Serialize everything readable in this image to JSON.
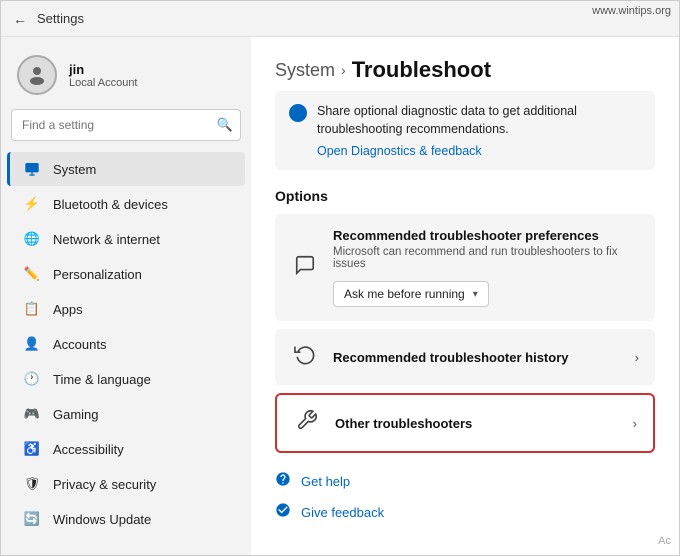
{
  "window": {
    "title": "Settings",
    "watermark": "www.wintips.org"
  },
  "titlebar": {
    "back_label": "←",
    "title": "Settings"
  },
  "sidebar": {
    "user": {
      "name": "jin",
      "type": "Local Account"
    },
    "search": {
      "placeholder": "Find a setting",
      "icon": "🔍"
    },
    "items": [
      {
        "id": "system",
        "label": "System",
        "icon": "🖥",
        "active": true
      },
      {
        "id": "bluetooth",
        "label": "Bluetooth & devices",
        "icon": "📶"
      },
      {
        "id": "network",
        "label": "Network & internet",
        "icon": "🌐"
      },
      {
        "id": "personalization",
        "label": "Personalization",
        "icon": "✏️"
      },
      {
        "id": "apps",
        "label": "Apps",
        "icon": "📦"
      },
      {
        "id": "accounts",
        "label": "Accounts",
        "icon": "👤"
      },
      {
        "id": "time",
        "label": "Time & language",
        "icon": "🕐"
      },
      {
        "id": "gaming",
        "label": "Gaming",
        "icon": "🎮"
      },
      {
        "id": "accessibility",
        "label": "Accessibility",
        "icon": "♿"
      },
      {
        "id": "privacy",
        "label": "Privacy & security",
        "icon": "🛡"
      },
      {
        "id": "windows-update",
        "label": "Windows Update",
        "icon": "🔄"
      }
    ]
  },
  "content": {
    "breadcrumb": {
      "parent": "System",
      "separator": "›",
      "current": "Troubleshoot"
    },
    "info_banner": {
      "text": "Share optional diagnostic data to get additional troubleshooting recommendations.",
      "link_text": "Open Diagnostics & feedback"
    },
    "options_title": "Options",
    "options": [
      {
        "id": "recommended-prefs",
        "icon": "💬",
        "title": "Recommended troubleshooter preferences",
        "desc": "Microsoft can recommend and run troubleshooters to fix issues",
        "has_dropdown": true,
        "dropdown_value": "Ask me before running",
        "has_chevron": false,
        "highlighted": false
      },
      {
        "id": "recommended-history",
        "icon": "🕑",
        "title": "Recommended troubleshooter history",
        "desc": "",
        "has_dropdown": false,
        "has_chevron": true,
        "highlighted": false
      },
      {
        "id": "other-troubleshooters",
        "icon": "🔧",
        "title": "Other troubleshooters",
        "desc": "",
        "has_dropdown": false,
        "has_chevron": true,
        "highlighted": true
      }
    ],
    "footer_links": [
      {
        "id": "get-help",
        "icon": "👤",
        "text": "Get help"
      },
      {
        "id": "give-feedback",
        "icon": "👤",
        "text": "Give feedback"
      }
    ],
    "activate_text": "Ac"
  }
}
